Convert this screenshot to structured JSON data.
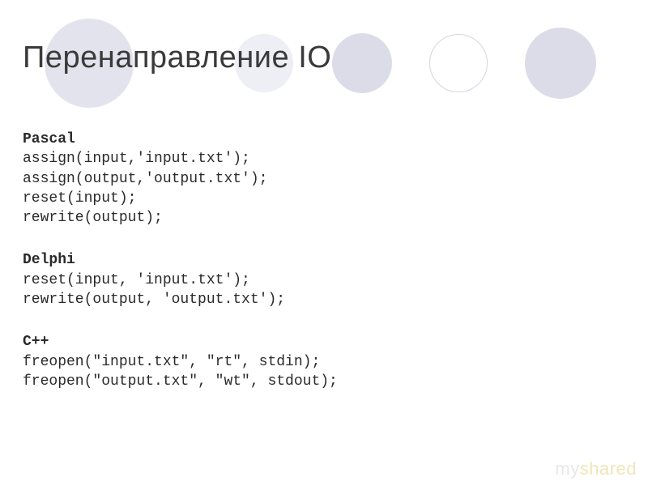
{
  "title": "Перенаправление IO",
  "sections": [
    {
      "label": "Pascal",
      "lines": [
        "assign(input,'input.txt');",
        "assign(output,'output.txt');",
        "reset(input);",
        "rewrite(output);"
      ]
    },
    {
      "label": "Delphi",
      "lines": [
        "reset(input, 'input.txt');",
        "rewrite(output, 'output.txt');"
      ]
    },
    {
      "label": "C++",
      "lines": [
        "freopen(\"input.txt\", \"rt\", stdin);",
        "freopen(\"output.txt\", \"wt\", stdout);"
      ]
    }
  ],
  "watermark_prefix": "my",
  "watermark_accent": "shared"
}
